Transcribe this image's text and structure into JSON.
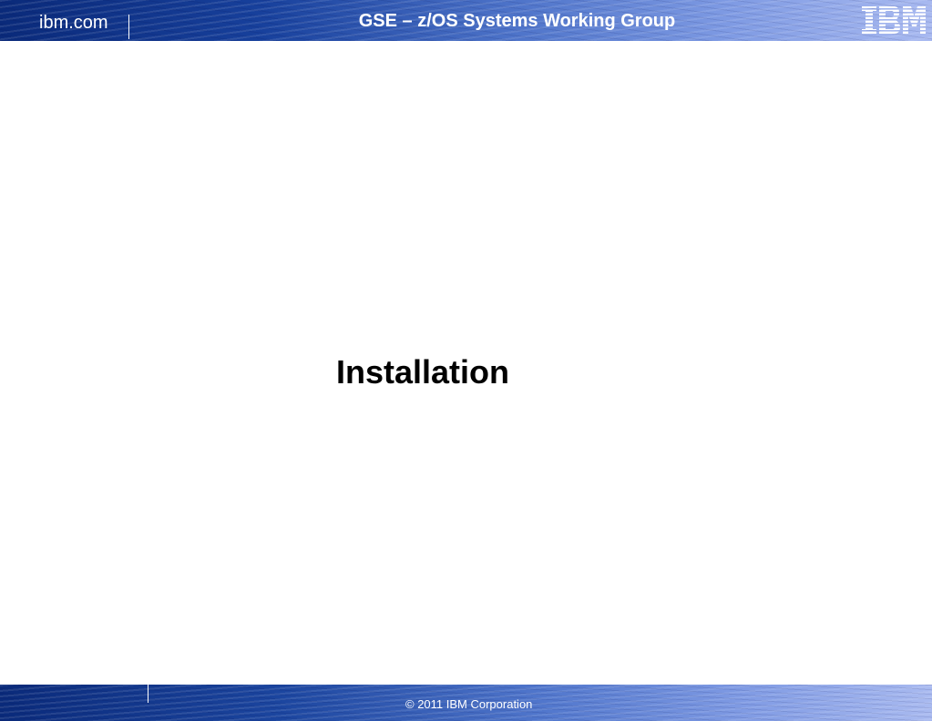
{
  "header": {
    "site_label": "ibm.com",
    "title": "GSE – z/OS Systems Working Group",
    "logo": "ibm-logo"
  },
  "main": {
    "title": "Installation"
  },
  "footer": {
    "copyright": "© 2011 IBM Corporation"
  },
  "colors": {
    "header_dark": "#0a2a7a",
    "header_light": "#a8b9f0",
    "title_text": "#000000",
    "band_text": "#ffffff"
  }
}
